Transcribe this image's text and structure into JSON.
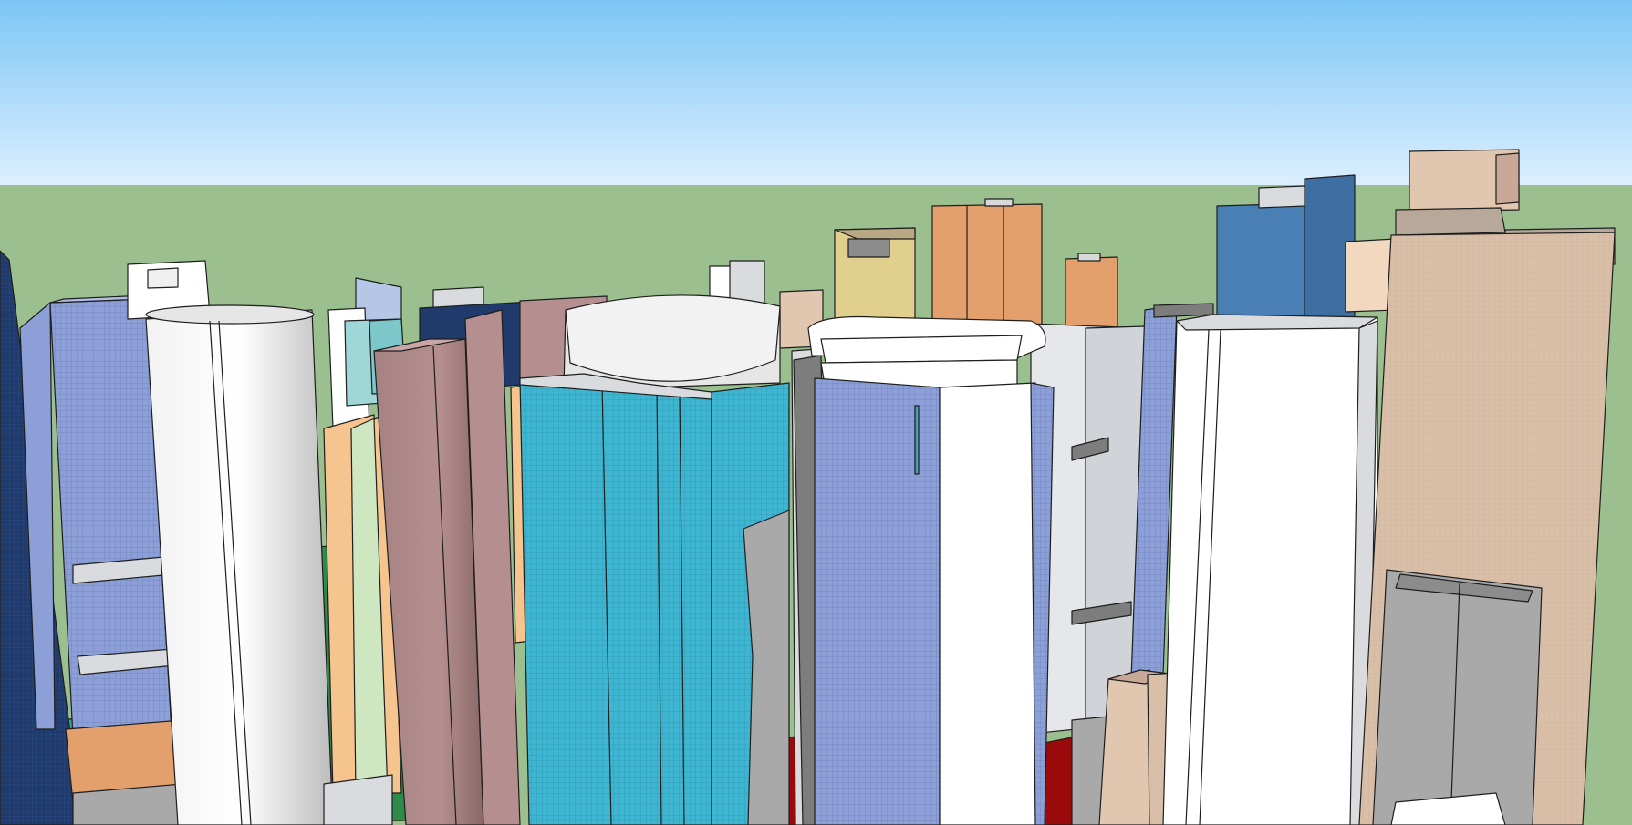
{
  "viewport": {
    "name": "3d-modeling-viewport",
    "sky_top": "#7cc6f5",
    "sky_bottom": "#dcefff",
    "ground": "#9bbf8e",
    "edge_color": "#1e1e1e"
  },
  "model": {
    "subject": "city-skyline-massing-model",
    "palette": {
      "navy": "#1f3a6b",
      "periwinkle": "#8c9fd6",
      "white": "#ffffff",
      "light_gray": "#d9dbde",
      "mid_gray": "#a9a9a9",
      "dark_gray": "#7d7d7d",
      "mauve": "#9b7676",
      "cyan": "#3eb6d1",
      "peach": "#f6c48e",
      "pale_green": "#cfe7c1",
      "tan": "#e1cf8e",
      "orange": "#e3a06d",
      "steel_blue": "#4a7fb5",
      "beige": "#e2c7b0",
      "teal": "#2aa6a6",
      "red": "#9a0a0a",
      "green": "#2e8b4a"
    }
  }
}
